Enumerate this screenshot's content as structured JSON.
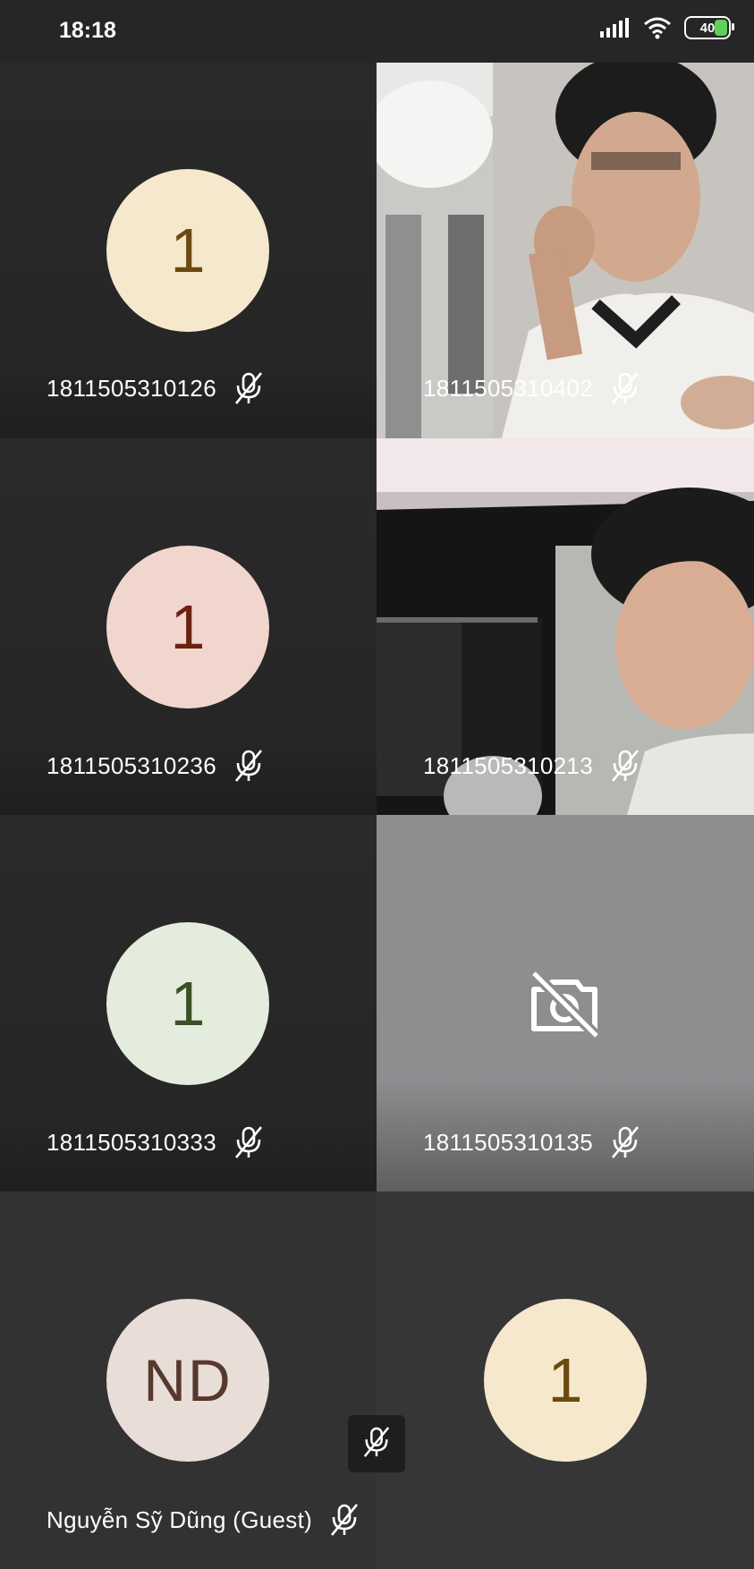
{
  "status_bar": {
    "time": "18:18",
    "battery": "40"
  },
  "participants": [
    {
      "name": "1811505310126",
      "avatar_initial": "1",
      "avatar_bg": "#f6e8cc",
      "avatar_fg": "#6b4a12",
      "muted": true
    },
    {
      "name": "1811505310402",
      "video": true,
      "muted": true
    },
    {
      "name": "1811505310236",
      "avatar_initial": "1",
      "avatar_bg": "#f1d6cd",
      "avatar_fg": "#6a2210",
      "muted": true
    },
    {
      "name": "1811505310213",
      "video": true,
      "muted": true
    },
    {
      "name": "1811505310333",
      "avatar_initial": "1",
      "avatar_bg": "#e4eddd",
      "avatar_fg": "#3c5028",
      "muted": true
    },
    {
      "name": "1811505310135",
      "camera_off": true,
      "muted": true
    },
    {
      "name": "Nguyễn Sỹ Dũng (Guest)",
      "avatar_initial": "ND",
      "avatar_bg": "#e9ddd8",
      "avatar_fg": "#56392c",
      "muted": true
    },
    {
      "name": "",
      "avatar_initial": "1",
      "avatar_bg": "#f6e8cc",
      "avatar_fg": "#6b4a12",
      "muted": false
    }
  ],
  "icons": {
    "mic_off": "mic-off-icon",
    "camera_off": "camera-off-icon"
  }
}
